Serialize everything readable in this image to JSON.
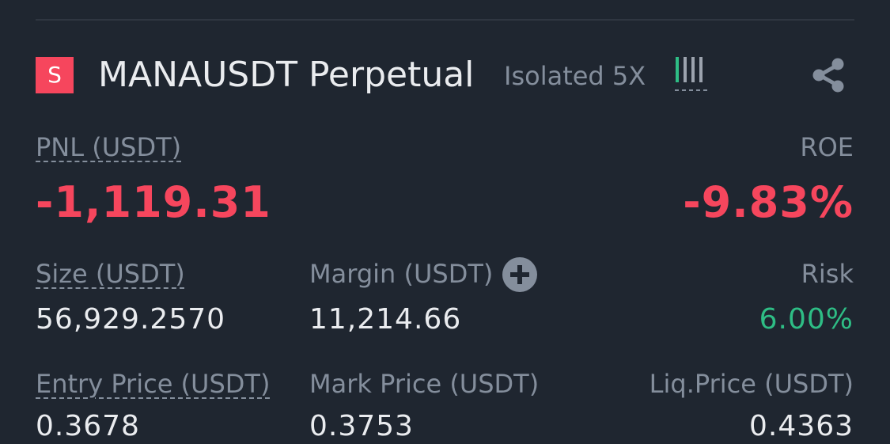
{
  "position": {
    "side_badge": "S",
    "symbol": "MANAUSDT Perpetual",
    "margin_mode": "Isolated 5X",
    "signal_icon": "adl-indicator-icon",
    "share_icon": "share-icon",
    "pnl": {
      "label": "PNL (USDT)",
      "value": "-1,119.31"
    },
    "roe": {
      "label": "ROE",
      "value": "-9.83%"
    },
    "size": {
      "label": "Size (USDT)",
      "value": "56,929.2570"
    },
    "margin": {
      "label": "Margin (USDT)",
      "value": "11,214.66",
      "add_icon": "plus-circle-icon"
    },
    "risk": {
      "label": "Risk",
      "value": "6.00%"
    },
    "entry_price": {
      "label": "Entry Price (USDT)",
      "value": "0.3678"
    },
    "mark_price": {
      "label": "Mark Price (USDT)",
      "value": "0.3753"
    },
    "liq_price": {
      "label": "Liq.Price (USDT)",
      "value": "0.4363"
    },
    "adl_level": "4 of 5"
  },
  "colors": {
    "background": "#1f2630",
    "loss": "#f6465d",
    "profit": "#2ebd85",
    "muted_text": "#848e9c",
    "primary_text": "#eaecef"
  }
}
